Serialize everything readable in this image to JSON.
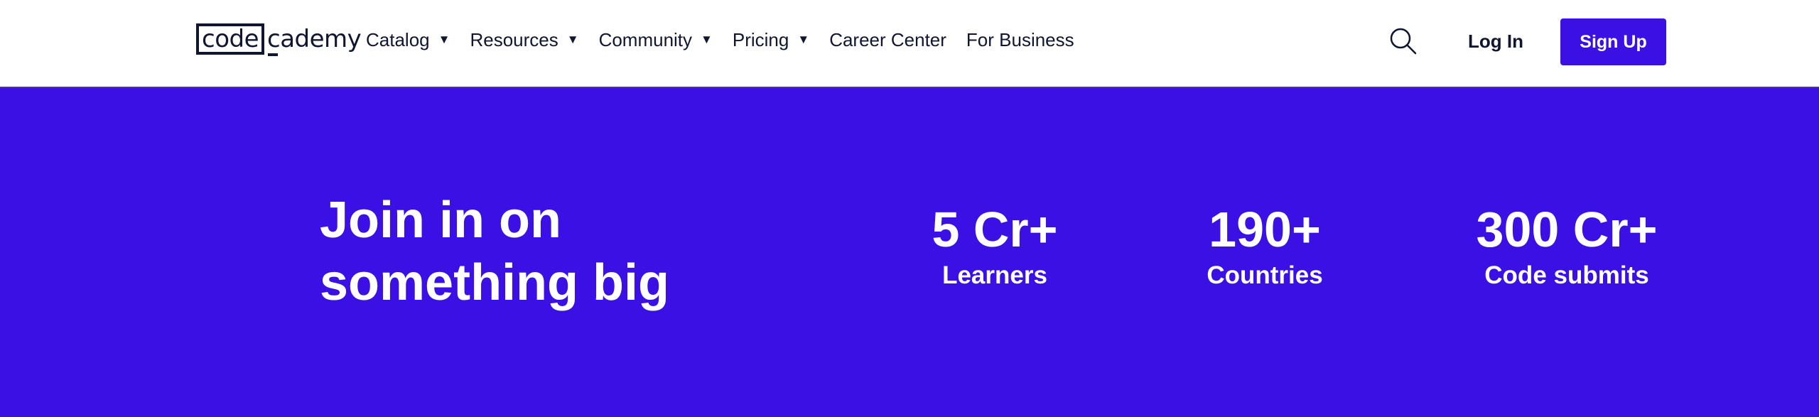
{
  "header": {
    "logo": {
      "boxed": "code",
      "rest": "cademy"
    },
    "nav": [
      {
        "label": "Catalog",
        "has_dropdown": true
      },
      {
        "label": "Resources",
        "has_dropdown": true
      },
      {
        "label": "Community",
        "has_dropdown": true
      },
      {
        "label": "Pricing",
        "has_dropdown": true
      },
      {
        "label": "Career Center",
        "has_dropdown": false
      },
      {
        "label": "For Business",
        "has_dropdown": false
      }
    ],
    "caret_glyph": "▼",
    "search_icon": "search-icon",
    "login_label": "Log In",
    "signup_label": "Sign Up"
  },
  "hero": {
    "title_line1": "Join in on",
    "title_line2": "something big",
    "stats": [
      {
        "value": "5 Cr+",
        "label": "Learners"
      },
      {
        "value": "190+",
        "label": "Countries"
      },
      {
        "value": "300 Cr+",
        "label": "Code submits"
      }
    ]
  },
  "colors": {
    "brand": "#3a10e5",
    "text_dark": "#10162f",
    "white": "#ffffff"
  }
}
